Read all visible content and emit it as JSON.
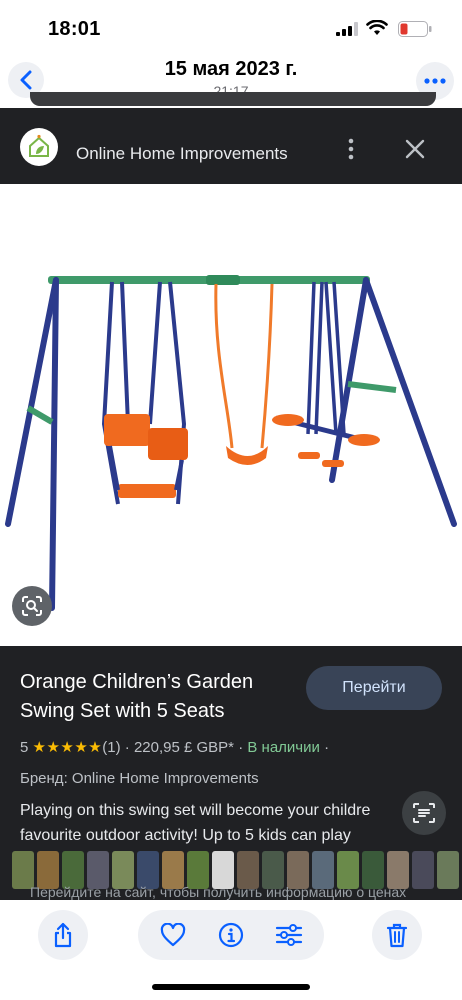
{
  "status_bar": {
    "time": "18:01"
  },
  "photos_header": {
    "date": "15 мая 2023 г.",
    "time": "21:17",
    "back_icon": "chevron-left-icon",
    "more_icon": "ellipsis-icon"
  },
  "lens": {
    "site_name": "Online Home Improvements",
    "product_title": "Orange Children’s Garden Swing Set with 5 Seats",
    "go_button": "Перейти",
    "rating_value": "5",
    "stars": "★★★★★",
    "review_count": "(1)",
    "price": "220,95 £ GBP*",
    "availability": "В наличии",
    "brand": "Бренд: Online Home Improvements",
    "description": "Playing on this swing set will become your childre favourite outdoor activity! Up to 5 kids can play",
    "redirect_note": "Перейдите на сайт, чтобы получить информацию о ценах"
  },
  "colors": {
    "accent_blue": "#0a60ff",
    "dark_bg": "#202124",
    "star": "#fbbc04",
    "in_stock": "#81c995"
  }
}
